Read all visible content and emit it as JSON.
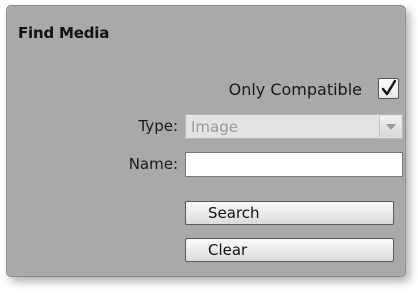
{
  "panel": {
    "title": "Find Media"
  },
  "filters": {
    "only_compatible_label": "Only Compatible",
    "only_compatible_checked": true,
    "type_label": "Type:",
    "type_value": "Image",
    "name_label": "Name:",
    "name_value": "",
    "name_placeholder": ""
  },
  "actions": {
    "search_label": "Search",
    "clear_label": "Clear"
  },
  "icons": {
    "checkmark": "check-icon",
    "dropdown_arrow": "chevron-down-icon"
  },
  "colors": {
    "panel_bg": "#a9a9a9",
    "disabled_text": "#9a9a9a"
  }
}
